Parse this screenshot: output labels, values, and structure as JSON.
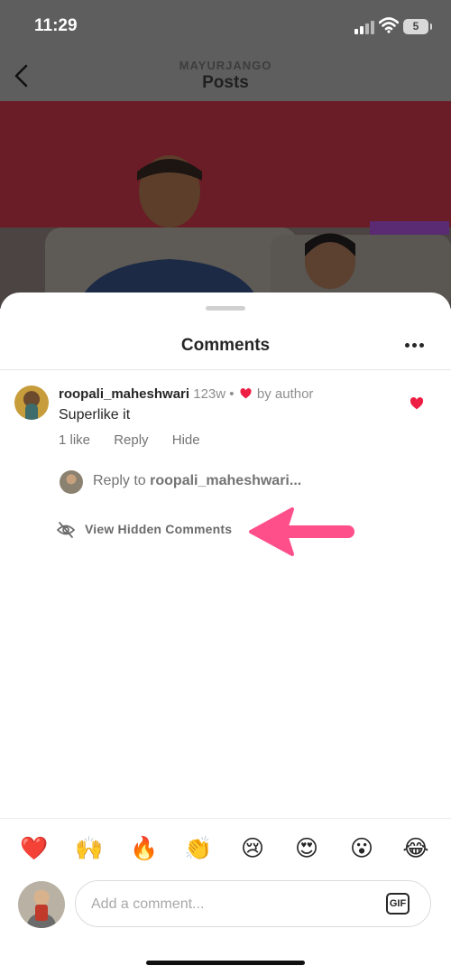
{
  "status_bar": {
    "time": "11:29",
    "battery": "5"
  },
  "header": {
    "username": "MAYURJANGO",
    "title": "Posts"
  },
  "sheet": {
    "title": "Comments"
  },
  "comment": {
    "username": "roopali_maheshwari",
    "age": "123w",
    "separator": "•",
    "liked_by": "by author",
    "text": "Superlike it",
    "likes": "1 like",
    "reply": "Reply",
    "hide": "Hide"
  },
  "reply_prompt": {
    "prefix": "Reply to",
    "username": "roopali_maheshwari..."
  },
  "hidden_comments": {
    "label": "View Hidden Comments"
  },
  "emojis": [
    "❤️",
    "🙌",
    "🔥",
    "👏",
    "😢",
    "😍",
    "😮",
    "😂"
  ],
  "composer": {
    "placeholder": "Add a comment...",
    "gif_label": "GIF"
  },
  "colors": {
    "heart": "#ed1d43",
    "arrow": "#ff4f8a"
  }
}
